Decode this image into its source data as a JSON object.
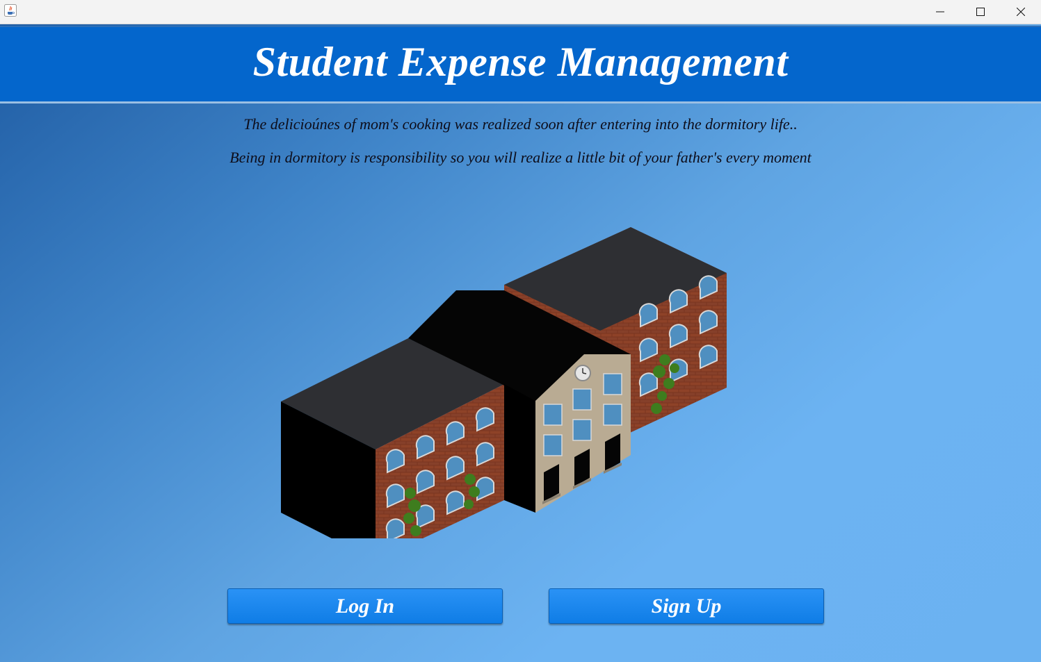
{
  "window": {
    "controls": [
      "minimize",
      "maximize",
      "close"
    ]
  },
  "header": {
    "title": "Student Expense Management"
  },
  "taglines": [
    "The delicioúnes of mom's cooking was realized soon after entering into the dormitory life..",
    "Being in dormitory is responsibility so you will realize a little bit of your father's every moment"
  ],
  "illustration": {
    "icon": "dormitory-building"
  },
  "actions": {
    "login_label": "Log In",
    "signup_label": "Sign Up"
  },
  "colors": {
    "header_bg": "#0466cc",
    "button_bg": "#1a88f0",
    "gradient_dark": "#1f5ca3",
    "gradient_light": "#6cb3f2"
  }
}
